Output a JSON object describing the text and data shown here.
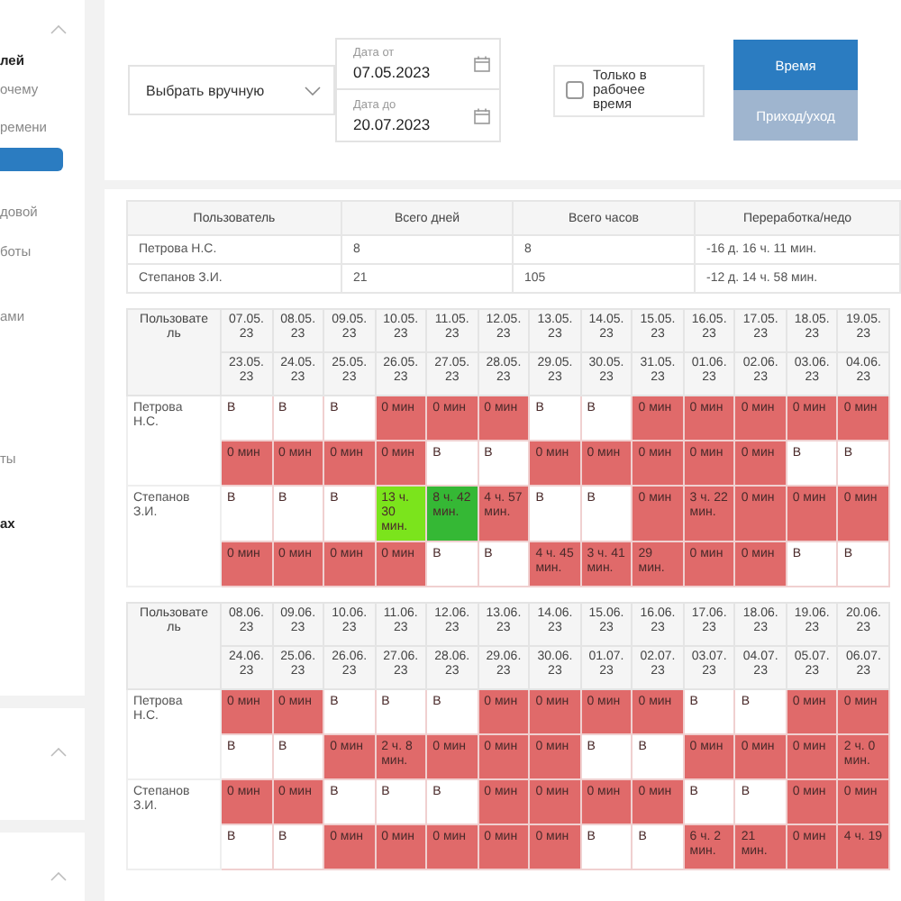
{
  "sidebar": {
    "items": [
      {
        "text": "лей",
        "bold": true,
        "selected": false
      },
      {
        "text": "очему",
        "bold": false,
        "selected": false
      },
      {
        "text": "ремени",
        "bold": false,
        "selected": false
      },
      {
        "selected": true
      },
      {
        "text": "довой",
        "bold": false,
        "selected": false
      },
      {
        "text": "боты",
        "bold": false,
        "selected": false
      },
      {
        "text": "ами",
        "bold": false,
        "selected": false
      },
      {
        "text": "ты",
        "bold": false,
        "selected": false
      },
      {
        "text": "ах",
        "bold": true,
        "selected": false
      }
    ]
  },
  "filters": {
    "period_select": {
      "value": "Выбрать вручную"
    },
    "date_from": {
      "label": "Дата от",
      "value": "07.05.2023"
    },
    "date_to": {
      "label": "Дата до",
      "value": "20.07.2023"
    },
    "working_time_only": {
      "label": "Только в рабочее время",
      "checked": false
    },
    "view_buttons": [
      {
        "label": "Время",
        "selected": true
      },
      {
        "label": "Приход/уход",
        "selected": false
      }
    ]
  },
  "summary_table": {
    "columns": [
      "Пользователь",
      "Всего дней",
      "Всего часов",
      "Переработка/недо"
    ],
    "rows": [
      [
        "Петрова Н.С.",
        "8",
        "8",
        "-16 д. 16 ч. 11 мин."
      ],
      [
        "Степанов З.И.",
        "21",
        "105",
        "-12 д. 14 ч. 58 мин."
      ]
    ]
  },
  "grids": [
    {
      "user_column": "Пользователь",
      "header_rows": [
        [
          "07.05.23",
          "08.05.23",
          "09.05.23",
          "10.05.23",
          "11.05.23",
          "12.05.23",
          "13.05.23",
          "14.05.23",
          "15.05.23",
          "16.05.23",
          "17.05.23",
          "18.05.23",
          "19.05.23"
        ],
        [
          "23.05.23",
          "24.05.23",
          "25.05.23",
          "26.05.23",
          "27.05.23",
          "28.05.23",
          "29.05.23",
          "30.05.23",
          "31.05.23",
          "01.06.23",
          "02.06.23",
          "03.06.23",
          "04.06.23"
        ]
      ],
      "users": [
        {
          "name": "Петрова Н.С.",
          "rows": [
            [
              {
                "text": "В",
                "color": "#ffffff"
              },
              {
                "text": "В",
                "color": "#ffffff"
              },
              {
                "text": "В",
                "color": "#ffffff"
              },
              {
                "text": "0 мин",
                "color": "#e06a6a"
              },
              {
                "text": "0 мин",
                "color": "#e06a6a"
              },
              {
                "text": "0 мин",
                "color": "#e06a6a"
              },
              {
                "text": "В",
                "color": "#ffffff"
              },
              {
                "text": "В",
                "color": "#ffffff"
              },
              {
                "text": "0 мин",
                "color": "#e06a6a"
              },
              {
                "text": "0 мин",
                "color": "#e06a6a"
              },
              {
                "text": "0 мин",
                "color": "#e06a6a"
              },
              {
                "text": "0 мин",
                "color": "#e06a6a"
              },
              {
                "text": "0 мин",
                "color": "#e06a6a"
              }
            ],
            [
              {
                "text": "0 мин",
                "color": "#e06a6a"
              },
              {
                "text": "0 мин",
                "color": "#e06a6a"
              },
              {
                "text": "0 мин",
                "color": "#e06a6a"
              },
              {
                "text": "0 мин",
                "color": "#e06a6a"
              },
              {
                "text": "В",
                "color": "#ffffff"
              },
              {
                "text": "В",
                "color": "#ffffff"
              },
              {
                "text": "0 мин",
                "color": "#e06a6a"
              },
              {
                "text": "0 мин",
                "color": "#e06a6a"
              },
              {
                "text": "0 мин",
                "color": "#e06a6a"
              },
              {
                "text": "0 мин",
                "color": "#e06a6a"
              },
              {
                "text": "0 мин",
                "color": "#e06a6a"
              },
              {
                "text": "В",
                "color": "#ffffff"
              },
              {
                "text": "В",
                "color": "#ffffff"
              }
            ]
          ]
        },
        {
          "name": "Степанов З.И.",
          "rows": [
            [
              {
                "text": "В",
                "color": "#ffffff"
              },
              {
                "text": "В",
                "color": "#ffffff"
              },
              {
                "text": "В",
                "color": "#ffffff"
              },
              {
                "text": "13 ч. 30 мин.",
                "color": "#7be41c"
              },
              {
                "text": "8 ч. 42 мин.",
                "color": "#35b835"
              },
              {
                "text": "4 ч. 57 мин.",
                "color": "#e06a6a"
              },
              {
                "text": "В",
                "color": "#ffffff"
              },
              {
                "text": "В",
                "color": "#ffffff"
              },
              {
                "text": "0 мин",
                "color": "#e06a6a"
              },
              {
                "text": "3 ч. 22 мин.",
                "color": "#e06a6a"
              },
              {
                "text": "0 мин",
                "color": "#e06a6a"
              },
              {
                "text": "0 мин",
                "color": "#e06a6a"
              },
              {
                "text": "0 мин",
                "color": "#e06a6a"
              }
            ],
            [
              {
                "text": "0 мин",
                "color": "#e06a6a"
              },
              {
                "text": "0 мин",
                "color": "#e06a6a"
              },
              {
                "text": "0 мин",
                "color": "#e06a6a"
              },
              {
                "text": "0 мин",
                "color": "#e06a6a"
              },
              {
                "text": "В",
                "color": "#ffffff"
              },
              {
                "text": "В",
                "color": "#ffffff"
              },
              {
                "text": "4 ч. 45 мин.",
                "color": "#e06a6a"
              },
              {
                "text": "3 ч. 41 мин.",
                "color": "#e06a6a"
              },
              {
                "text": "29 мин.",
                "color": "#e06a6a"
              },
              {
                "text": "0 мин",
                "color": "#e06a6a"
              },
              {
                "text": "0 мин",
                "color": "#e06a6a"
              },
              {
                "text": "В",
                "color": "#ffffff"
              },
              {
                "text": "В",
                "color": "#ffffff"
              }
            ]
          ]
        }
      ]
    },
    {
      "user_column": "Пользователь",
      "header_rows": [
        [
          "08.06.23",
          "09.06.23",
          "10.06.23",
          "11.06.23",
          "12.06.23",
          "13.06.23",
          "14.06.23",
          "15.06.23",
          "16.06.23",
          "17.06.23",
          "18.06.23",
          "19.06.23",
          "20.06.23"
        ],
        [
          "24.06.23",
          "25.06.23",
          "26.06.23",
          "27.06.23",
          "28.06.23",
          "29.06.23",
          "30.06.23",
          "01.07.23",
          "02.07.23",
          "03.07.23",
          "04.07.23",
          "05.07.23",
          "06.07.23"
        ]
      ],
      "users": [
        {
          "name": "Петрова Н.С.",
          "rows": [
            [
              {
                "text": "0 мин",
                "color": "#e06a6a"
              },
              {
                "text": "0 мин",
                "color": "#e06a6a"
              },
              {
                "text": "В",
                "color": "#ffffff"
              },
              {
                "text": "В",
                "color": "#ffffff"
              },
              {
                "text": "В",
                "color": "#ffffff"
              },
              {
                "text": "0 мин",
                "color": "#e06a6a"
              },
              {
                "text": "0 мин",
                "color": "#e06a6a"
              },
              {
                "text": "0 мин",
                "color": "#e06a6a"
              },
              {
                "text": "0 мин",
                "color": "#e06a6a"
              },
              {
                "text": "В",
                "color": "#ffffff"
              },
              {
                "text": "В",
                "color": "#ffffff"
              },
              {
                "text": "0 мин",
                "color": "#e06a6a"
              },
              {
                "text": "0 мин",
                "color": "#e06a6a"
              }
            ],
            [
              {
                "text": "В",
                "color": "#ffffff"
              },
              {
                "text": "В",
                "color": "#ffffff"
              },
              {
                "text": "0 мин",
                "color": "#e06a6a"
              },
              {
                "text": "2 ч. 8 мин.",
                "color": "#e06a6a"
              },
              {
                "text": "0 мин",
                "color": "#e06a6a"
              },
              {
                "text": "0 мин",
                "color": "#e06a6a"
              },
              {
                "text": "0 мин",
                "color": "#e06a6a"
              },
              {
                "text": "В",
                "color": "#ffffff"
              },
              {
                "text": "В",
                "color": "#ffffff"
              },
              {
                "text": "0 мин",
                "color": "#e06a6a"
              },
              {
                "text": "0 мин",
                "color": "#e06a6a"
              },
              {
                "text": "0 мин",
                "color": "#e06a6a"
              },
              {
                "text": "2 ч. 0 мин.",
                "color": "#e06a6a"
              }
            ]
          ]
        },
        {
          "name": "Степанов З.И.",
          "rows": [
            [
              {
                "text": "0 мин",
                "color": "#e06a6a"
              },
              {
                "text": "0 мин",
                "color": "#e06a6a"
              },
              {
                "text": "В",
                "color": "#ffffff"
              },
              {
                "text": "В",
                "color": "#ffffff"
              },
              {
                "text": "В",
                "color": "#ffffff"
              },
              {
                "text": "0 мин",
                "color": "#e06a6a"
              },
              {
                "text": "0 мин",
                "color": "#e06a6a"
              },
              {
                "text": "0 мин",
                "color": "#e06a6a"
              },
              {
                "text": "0 мин",
                "color": "#e06a6a"
              },
              {
                "text": "В",
                "color": "#ffffff"
              },
              {
                "text": "В",
                "color": "#ffffff"
              },
              {
                "text": "0 мин",
                "color": "#e06a6a"
              },
              {
                "text": "0 мин",
                "color": "#e06a6a"
              }
            ],
            [
              {
                "text": "В",
                "color": "#ffffff"
              },
              {
                "text": "В",
                "color": "#ffffff"
              },
              {
                "text": "0 мин",
                "color": "#e06a6a"
              },
              {
                "text": "0 мин",
                "color": "#e06a6a"
              },
              {
                "text": "0 мин",
                "color": "#e06a6a"
              },
              {
                "text": "0 мин",
                "color": "#e06a6a"
              },
              {
                "text": "0 мин",
                "color": "#e06a6a"
              },
              {
                "text": "В",
                "color": "#ffffff"
              },
              {
                "text": "В",
                "color": "#ffffff"
              },
              {
                "text": "6 ч. 2 мин.",
                "color": "#e06a6a"
              },
              {
                "text": "21 мин.",
                "color": "#e06a6a"
              },
              {
                "text": "0 мин",
                "color": "#e06a6a"
              },
              {
                "text": "4 ч. 19",
                "color": "#e06a6a"
              }
            ]
          ]
        }
      ]
    }
  ]
}
